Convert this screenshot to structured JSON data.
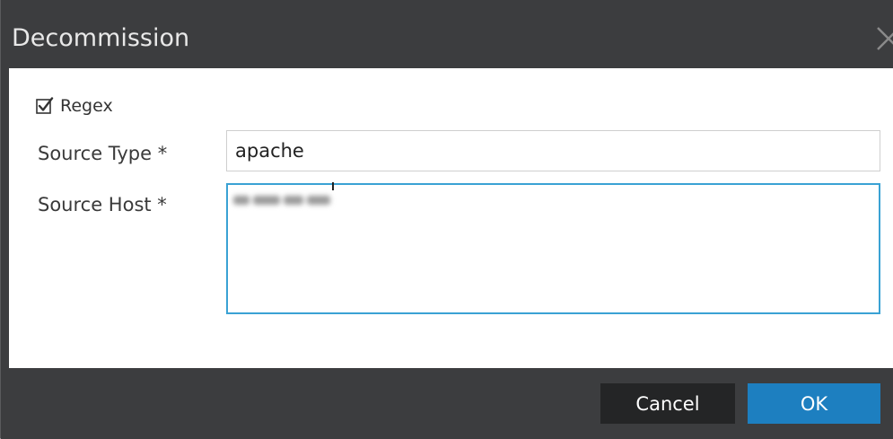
{
  "dialog": {
    "title": "Decommission",
    "close_icon": "close-icon"
  },
  "form": {
    "regex": {
      "label": "Regex",
      "checked": true
    },
    "source_type": {
      "label": "Source Type *",
      "value": "apache"
    },
    "source_host": {
      "label": "Source Host *"
    }
  },
  "footer": {
    "cancel_label": "Cancel",
    "ok_label": "OK"
  },
  "colors": {
    "frame": "#3c3d3f",
    "ok_button": "#1d7fc0",
    "cancel_button": "#242526",
    "focus_border": "#3aa2d4"
  }
}
